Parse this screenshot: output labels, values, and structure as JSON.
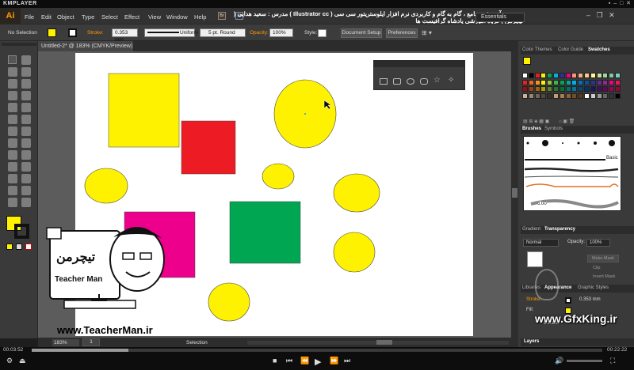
{
  "player": {
    "name": "KMPLAYER",
    "time_elapsed": "00:03:52",
    "time_total": "00:22:22",
    "progress": 0.17,
    "controls": [
      "pin-icon",
      "minimize-icon",
      "maximize-icon",
      "close-icon"
    ]
  },
  "app": {
    "logo": "Ai",
    "menus": [
      "File",
      "Edit",
      "Object",
      "Type",
      "Select",
      "Effect",
      "View",
      "Window",
      "Help"
    ],
    "mode_badges": [
      "Br",
      "St"
    ],
    "title_banner": "مجموعه آموزشی جامع ، گام به گام و کاربردی نرم افزار ایلوستریتور سی سی ( Illustrator cc )  مدرس : سعید هدایی ( تیچرمن ) گروه آموزشی پادشاه گرافیست ها",
    "workspace": "Essentials"
  },
  "control_bar": {
    "selection": "No Selection",
    "stroke_label": "Stroke:",
    "stroke_value": "0.353 mm",
    "profile": "Uniform",
    "brush": "5 pt. Round",
    "opacity_label": "Opacity:",
    "opacity_value": "100%",
    "style_label": "Style:",
    "document_setup": "Document Setup",
    "preferences": "Preferences"
  },
  "document": {
    "tab_title": "Untitled-2* @ 183% (CMYK/Preview)",
    "zoom": "183%",
    "status": "Selection",
    "page": "1"
  },
  "colors": {
    "yellow": "#fff200",
    "red": "#ed1c24",
    "magenta": "#ec008c",
    "green": "#00a651",
    "panel_bg": "#3a3a3a",
    "accent": "#ff9a00"
  },
  "panels": {
    "swatch_tabs": [
      "Color Themes",
      "Color Guide",
      "Swatches"
    ],
    "brush_tabs": [
      "Brushes",
      "Symbols"
    ],
    "brush_label": "Basic",
    "brush_size": "6.00",
    "transparency_tabs": [
      "Gradient",
      "Transparency"
    ],
    "blend_mode": "Normal",
    "opacity_label": "Opacity:",
    "opacity_value": "100%",
    "make_mask": "Make Mask",
    "clip": "Clip",
    "invert_mask": "Invert Mask",
    "appearance_tabs": [
      "Libraries",
      "Appearance",
      "Graphic Styles"
    ],
    "appearance_stroke_label": "Stroke:",
    "appearance_stroke_value": "0.353 mm",
    "appearance_fill": "Fill:",
    "appearance_opacity": "Default",
    "layers_tab": "Layers"
  },
  "watermarks": {
    "logo_title": "تیچرمن",
    "logo_name": "Teacher Man",
    "left_url": "www.TeacherMan.ir",
    "right_url": "www.GfxKing.ir"
  }
}
